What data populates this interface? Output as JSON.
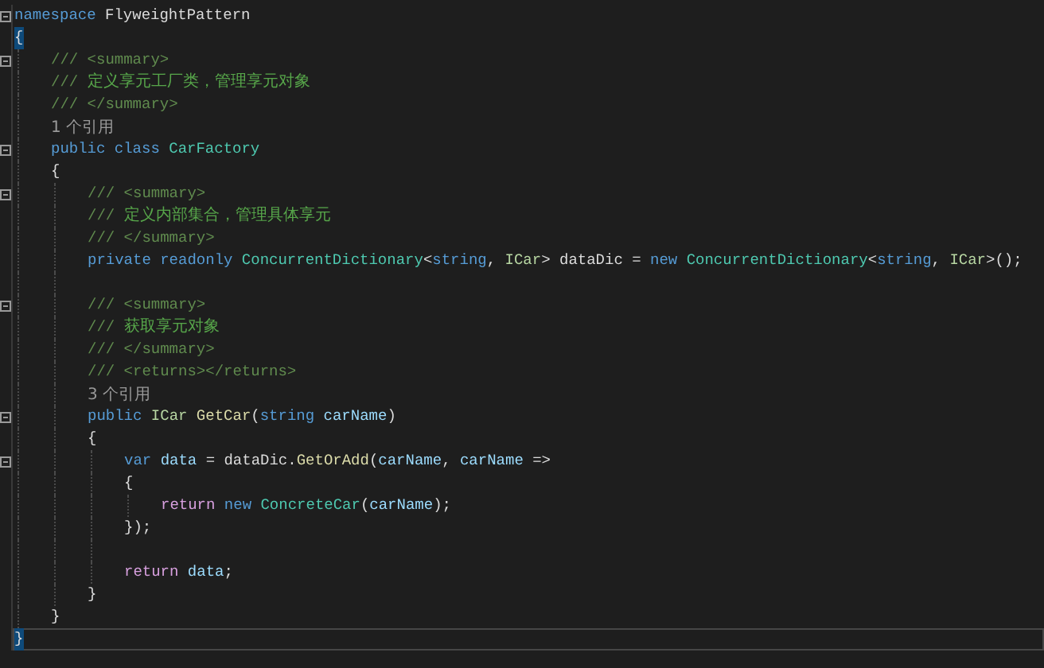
{
  "editor": {
    "lines": [
      {
        "kind": "code",
        "foldable": true,
        "current": false,
        "tokens": [
          {
            "text": "namespace",
            "kind": "keyword"
          },
          {
            "text": " FlyweightPattern",
            "kind": "plain"
          }
        ]
      },
      {
        "kind": "code",
        "foldable": false,
        "current": false,
        "tokens": [
          {
            "text": "{",
            "kind": "brace-match"
          }
        ]
      },
      {
        "kind": "block",
        "children": [
          {
            "kind": "code",
            "foldable": true,
            "current": false,
            "tokens": [
              {
                "text": "/// <summary>",
                "kind": "doc-tag"
              }
            ]
          },
          {
            "kind": "code",
            "foldable": false,
            "current": false,
            "tokens": [
              {
                "text": "/// ",
                "kind": "doc-tag"
              },
              {
                "text": "定义享元工厂类，管理享元对象",
                "kind": "comment"
              }
            ]
          },
          {
            "kind": "code",
            "foldable": false,
            "current": false,
            "tokens": [
              {
                "text": "/// </summary>",
                "kind": "doc-tag"
              }
            ]
          },
          {
            "kind": "lens",
            "text": "1 个引用"
          },
          {
            "kind": "code",
            "foldable": true,
            "current": false,
            "tokens": [
              {
                "text": "public class ",
                "kind": "keyword"
              },
              {
                "text": "CarFactory",
                "kind": "type"
              }
            ]
          },
          {
            "kind": "code",
            "foldable": false,
            "current": false,
            "tokens": [
              {
                "text": "{",
                "kind": "plain"
              }
            ]
          },
          {
            "kind": "block",
            "children": [
              {
                "kind": "code",
                "foldable": true,
                "current": false,
                "tokens": [
                  {
                    "text": "/// <summary>",
                    "kind": "doc-tag"
                  }
                ]
              },
              {
                "kind": "code",
                "foldable": false,
                "current": false,
                "tokens": [
                  {
                    "text": "/// ",
                    "kind": "doc-tag"
                  },
                  {
                    "text": "定义内部集合，管理具体享元",
                    "kind": "comment"
                  }
                ]
              },
              {
                "kind": "code",
                "foldable": false,
                "current": false,
                "tokens": [
                  {
                    "text": "/// </summary>",
                    "kind": "doc-tag"
                  }
                ]
              },
              {
                "kind": "code",
                "foldable": false,
                "current": false,
                "tokens": [
                  {
                    "text": "private readonly ",
                    "kind": "keyword"
                  },
                  {
                    "text": "ConcurrentDictionary",
                    "kind": "type"
                  },
                  {
                    "text": "<",
                    "kind": "plain"
                  },
                  {
                    "text": "string",
                    "kind": "keyword"
                  },
                  {
                    "text": ", ",
                    "kind": "plain"
                  },
                  {
                    "text": "ICar",
                    "kind": "interface"
                  },
                  {
                    "text": "> dataDic = ",
                    "kind": "plain"
                  },
                  {
                    "text": "new ",
                    "kind": "keyword"
                  },
                  {
                    "text": "ConcurrentDictionary",
                    "kind": "type"
                  },
                  {
                    "text": "<",
                    "kind": "plain"
                  },
                  {
                    "text": "string",
                    "kind": "keyword"
                  },
                  {
                    "text": ", ",
                    "kind": "plain"
                  },
                  {
                    "text": "ICar",
                    "kind": "interface"
                  },
                  {
                    "text": ">();",
                    "kind": "plain"
                  }
                ]
              },
              {
                "kind": "blank"
              },
              {
                "kind": "code",
                "foldable": true,
                "current": false,
                "tokens": [
                  {
                    "text": "/// <summary>",
                    "kind": "doc-tag"
                  }
                ]
              },
              {
                "kind": "code",
                "foldable": false,
                "current": false,
                "tokens": [
                  {
                    "text": "/// ",
                    "kind": "doc-tag"
                  },
                  {
                    "text": "获取享元对象",
                    "kind": "comment"
                  }
                ]
              },
              {
                "kind": "code",
                "foldable": false,
                "current": false,
                "tokens": [
                  {
                    "text": "/// </summary>",
                    "kind": "doc-tag"
                  }
                ]
              },
              {
                "kind": "code",
                "foldable": false,
                "current": false,
                "tokens": [
                  {
                    "text": "/// <returns></returns>",
                    "kind": "doc-tag"
                  }
                ]
              },
              {
                "kind": "lens",
                "text": "3 个引用"
              },
              {
                "kind": "code",
                "foldable": true,
                "current": false,
                "tokens": [
                  {
                    "text": "public ",
                    "kind": "keyword"
                  },
                  {
                    "text": "ICar",
                    "kind": "interface"
                  },
                  {
                    "text": " GetCar",
                    "kind": "method"
                  },
                  {
                    "text": "(",
                    "kind": "plain"
                  },
                  {
                    "text": "string ",
                    "kind": "keyword"
                  },
                  {
                    "text": "carName",
                    "kind": "param"
                  },
                  {
                    "text": ")",
                    "kind": "plain"
                  }
                ]
              },
              {
                "kind": "code",
                "foldable": false,
                "current": false,
                "tokens": [
                  {
                    "text": "{",
                    "kind": "plain"
                  }
                ]
              },
              {
                "kind": "block",
                "children": [
                  {
                    "kind": "code",
                    "foldable": true,
                    "current": false,
                    "tokens": [
                      {
                        "text": "var ",
                        "kind": "keyword"
                      },
                      {
                        "text": "data",
                        "kind": "param"
                      },
                      {
                        "text": " = dataDic.",
                        "kind": "plain"
                      },
                      {
                        "text": "GetOrAdd",
                        "kind": "method"
                      },
                      {
                        "text": "(",
                        "kind": "plain"
                      },
                      {
                        "text": "carName",
                        "kind": "param"
                      },
                      {
                        "text": ", ",
                        "kind": "plain"
                      },
                      {
                        "text": "carName",
                        "kind": "param"
                      },
                      {
                        "text": " =>",
                        "kind": "plain"
                      }
                    ]
                  },
                  {
                    "kind": "code",
                    "foldable": false,
                    "current": false,
                    "tokens": [
                      {
                        "text": "{",
                        "kind": "plain"
                      }
                    ]
                  },
                  {
                    "kind": "block",
                    "children": [
                      {
                        "kind": "code",
                        "foldable": false,
                        "current": false,
                        "tokens": [
                          {
                            "text": "return ",
                            "kind": "control"
                          },
                          {
                            "text": "new ",
                            "kind": "keyword"
                          },
                          {
                            "text": "ConcreteCar",
                            "kind": "type"
                          },
                          {
                            "text": "(",
                            "kind": "plain"
                          },
                          {
                            "text": "carName",
                            "kind": "param"
                          },
                          {
                            "text": ");",
                            "kind": "plain"
                          }
                        ]
                      }
                    ]
                  },
                  {
                    "kind": "code",
                    "foldable": false,
                    "current": false,
                    "tokens": [
                      {
                        "text": "});",
                        "kind": "plain"
                      }
                    ]
                  },
                  {
                    "kind": "blank"
                  },
                  {
                    "kind": "code",
                    "foldable": false,
                    "current": false,
                    "tokens": [
                      {
                        "text": "return ",
                        "kind": "control"
                      },
                      {
                        "text": "data",
                        "kind": "param"
                      },
                      {
                        "text": ";",
                        "kind": "plain"
                      }
                    ]
                  }
                ]
              },
              {
                "kind": "code",
                "foldable": false,
                "current": false,
                "tokens": [
                  {
                    "text": "}",
                    "kind": "plain"
                  }
                ]
              }
            ]
          },
          {
            "kind": "code",
            "foldable": false,
            "current": false,
            "tokens": [
              {
                "text": "}",
                "kind": "plain"
              }
            ]
          }
        ]
      },
      {
        "kind": "code",
        "foldable": false,
        "current": true,
        "tokens": [
          {
            "text": "}",
            "kind": "brace-match"
          }
        ]
      }
    ]
  }
}
